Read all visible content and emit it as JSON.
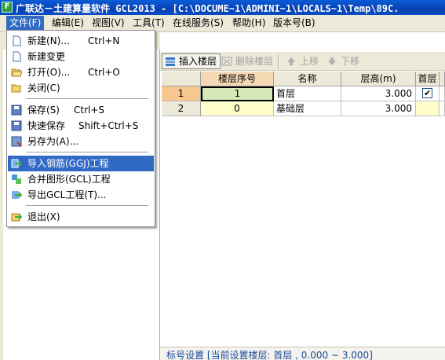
{
  "window": {
    "title": "广联达－土建算量软件 GCL2013 - [C:\\DOCUME~1\\ADMINI~1\\LOCALS~1\\Temp\\89C."
  },
  "menubar": {
    "items": [
      "文件(F)",
      "编辑(E)",
      "视图(V)",
      "工具(T)",
      "在线服务(S)",
      "帮助(H)",
      "版本号(B)"
    ]
  },
  "file_menu": {
    "items": [
      {
        "label": "新建(N)...",
        "shortcut": "Ctrl+N",
        "icon": "new-file-icon"
      },
      {
        "label": "新建变更",
        "shortcut": "",
        "icon": "new-change-icon"
      },
      {
        "label": "打开(O)...",
        "shortcut": "Ctrl+O",
        "icon": "open-folder-icon"
      },
      {
        "label": "关闭(C)",
        "shortcut": "",
        "icon": "close-folder-icon"
      },
      {
        "label": "保存(S)",
        "shortcut": "Ctrl+S",
        "icon": "save-icon"
      },
      {
        "label": "快速保存",
        "shortcut": "Shift+Ctrl+S",
        "icon": "quick-save-icon"
      },
      {
        "label": "另存为(A)...",
        "shortcut": "",
        "icon": "save-as-icon"
      },
      {
        "label": "导入钢筋(GGJ)工程",
        "shortcut": "",
        "icon": "import-rebar-icon"
      },
      {
        "label": "合并图形(GCL)工程",
        "shortcut": "",
        "icon": "merge-project-icon"
      },
      {
        "label": "导出GCL工程(T)...",
        "shortcut": "",
        "icon": "export-project-icon"
      },
      {
        "label": "退出(X)",
        "shortcut": "",
        "icon": "exit-icon"
      }
    ]
  },
  "toolbar": {
    "insert_floor": "插入楼层",
    "delete_floor": "删除楼层",
    "move_up": "上移",
    "move_down": "下移"
  },
  "floor_table": {
    "columns": [
      "楼层序号",
      "名称",
      "层高(m)",
      "首层"
    ],
    "rows": [
      {
        "row": "1",
        "seq": "1",
        "name": "首层",
        "height": "3.000",
        "first_floor": true
      },
      {
        "row": "2",
        "seq": "0",
        "name": "基础层",
        "height": "3.000",
        "first_floor": false
      }
    ]
  },
  "statusbar": {
    "text": "标号设置 [当前设置楼层: 首层 , 0.000 ~ 3.000]"
  },
  "colors": {
    "menu_highlight": "#316ac5",
    "title_bar": "#0842b4",
    "selected_cell": "#d4e8b8",
    "header_highlight": "#f5d8b4"
  }
}
